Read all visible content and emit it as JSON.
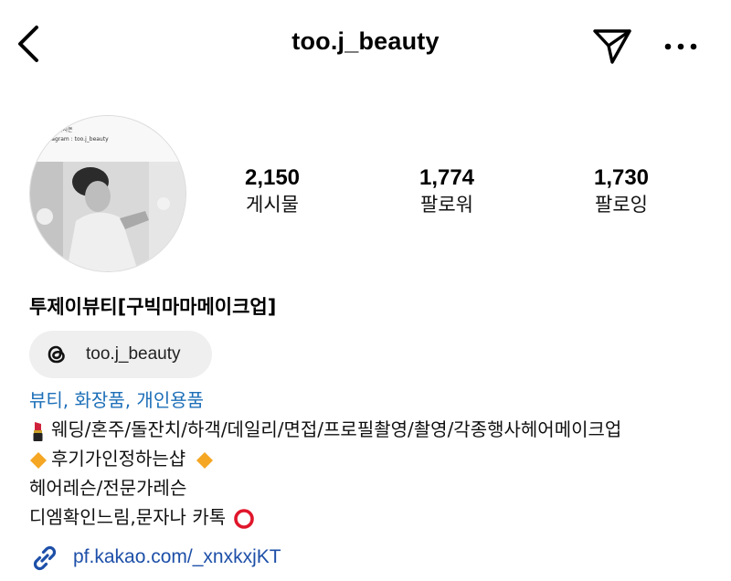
{
  "header": {
    "username": "too.j_beauty",
    "back_icon": "chevron-left-icon",
    "send_icon": "paper-plane-icon",
    "more_icon": "more-horizontal-icon"
  },
  "profile": {
    "avatar_caption_lines": [
      ": 최지은",
      "nstagram : too.j_beauty"
    ],
    "stats": {
      "posts": {
        "count": "2,150",
        "label": "게시물"
      },
      "followers": {
        "count": "1,774",
        "label": "팔로워"
      },
      "following": {
        "count": "1,730",
        "label": "팔로잉"
      }
    },
    "display_name": "투제이뷰티[구빅마마메이크업]",
    "threads": {
      "icon": "threads-icon",
      "label": "too.j_beauty"
    },
    "category": "뷰티, 화장품, 개인용품",
    "bio": [
      {
        "emoji": "lipstick-emoji",
        "text": "웨딩/혼주/돌잔치/하객/데일리/면접/프로필촬영/촬영/각종행사헤어메이크업"
      },
      {
        "emoji": "orange-diamond-emoji",
        "text": "후기가인정하는샵",
        "emoji_after": "orange-diamond-emoji"
      },
      {
        "text": "헤어레슨/전문가레슨"
      },
      {
        "text": "디엠확인느림,문자나 카톡",
        "emoji_after": "red-circle-emoji"
      }
    ],
    "link": {
      "icon": "link-icon",
      "url": "pf.kakao.com/_xnxkxjKT"
    }
  },
  "colors": {
    "accent_link": "#1d4fa8",
    "category": "#1d6fb8",
    "chip_bg": "#efefef",
    "diamond": "#f5a623",
    "lipstick": "#d0213a",
    "red_circle": "#e0162b"
  }
}
